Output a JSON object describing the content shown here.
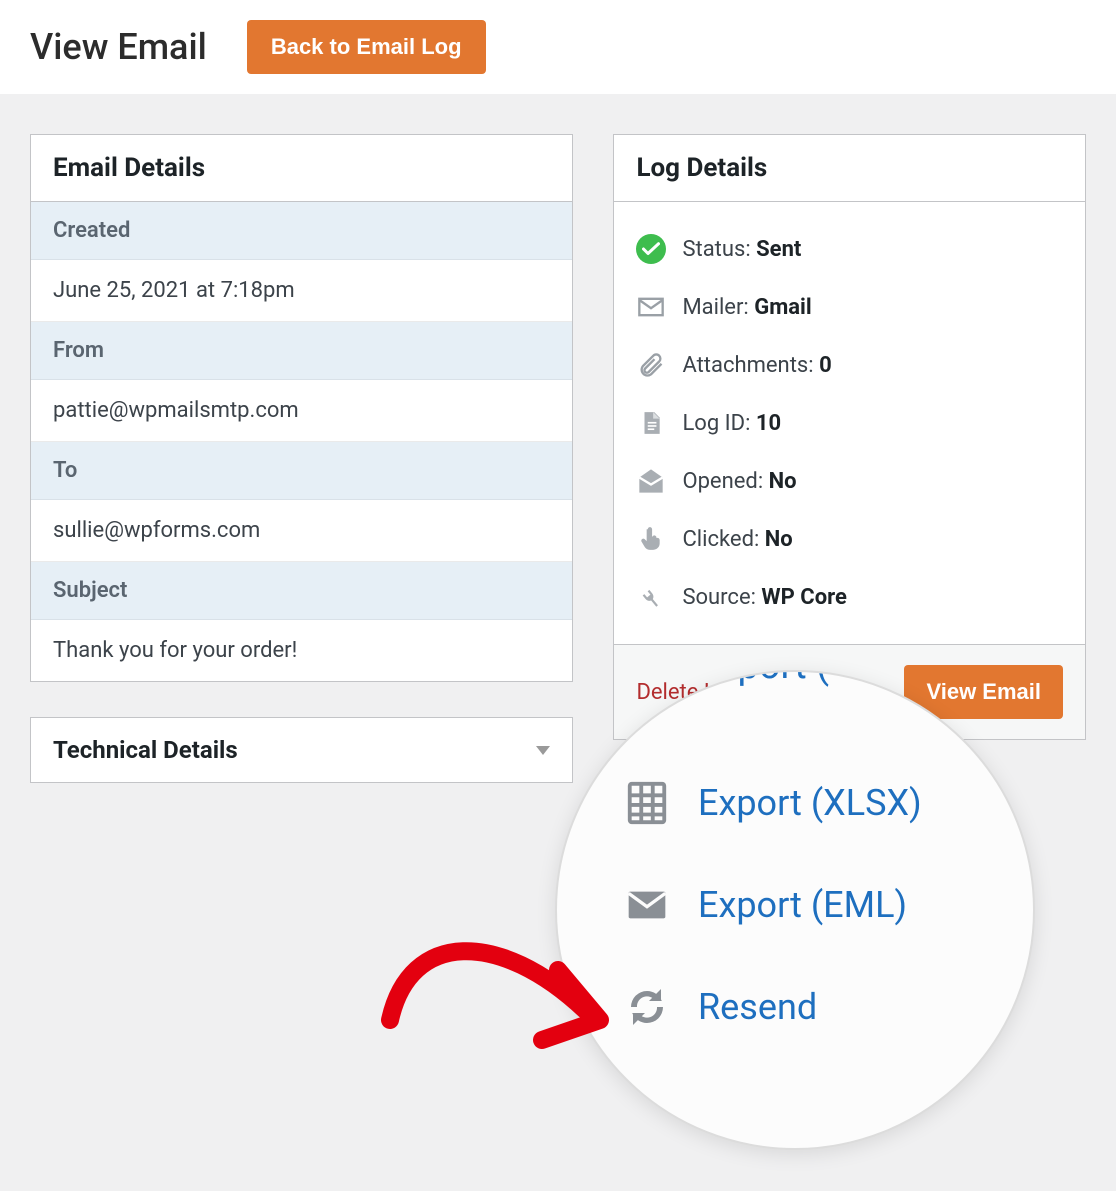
{
  "header": {
    "title": "View Email",
    "back_button": "Back to Email Log"
  },
  "email_details": {
    "title": "Email Details",
    "created_label": "Created",
    "created_value": "June 25, 2021 at 7:18pm",
    "from_label": "From",
    "from_value": "pattie@wpmailsmtp.com",
    "to_label": "To",
    "to_value": "sullie@wpforms.com",
    "subject_label": "Subject",
    "subject_value": "Thank you for your order!"
  },
  "technical_details": {
    "title": "Technical Details"
  },
  "log_details": {
    "title": "Log Details",
    "status_label": "Status:",
    "status_value": "Sent",
    "mailer_label": "Mailer:",
    "mailer_value": "Gmail",
    "attachments_label": "Attachments:",
    "attachments_value": "0",
    "logid_label": "Log ID:",
    "logid_value": "10",
    "opened_label": "Opened:",
    "opened_value": "No",
    "clicked_label": "Clicked:",
    "clicked_value": "No",
    "source_label": "Source:",
    "source_value": "WP Core",
    "delete_label": "Delete Log",
    "view_label": "View Email"
  },
  "actions": {
    "export_cut": "Export (",
    "export_xlsx": "Export (XLSX)",
    "export_eml": "Export (EML)",
    "resend": "Resend"
  }
}
